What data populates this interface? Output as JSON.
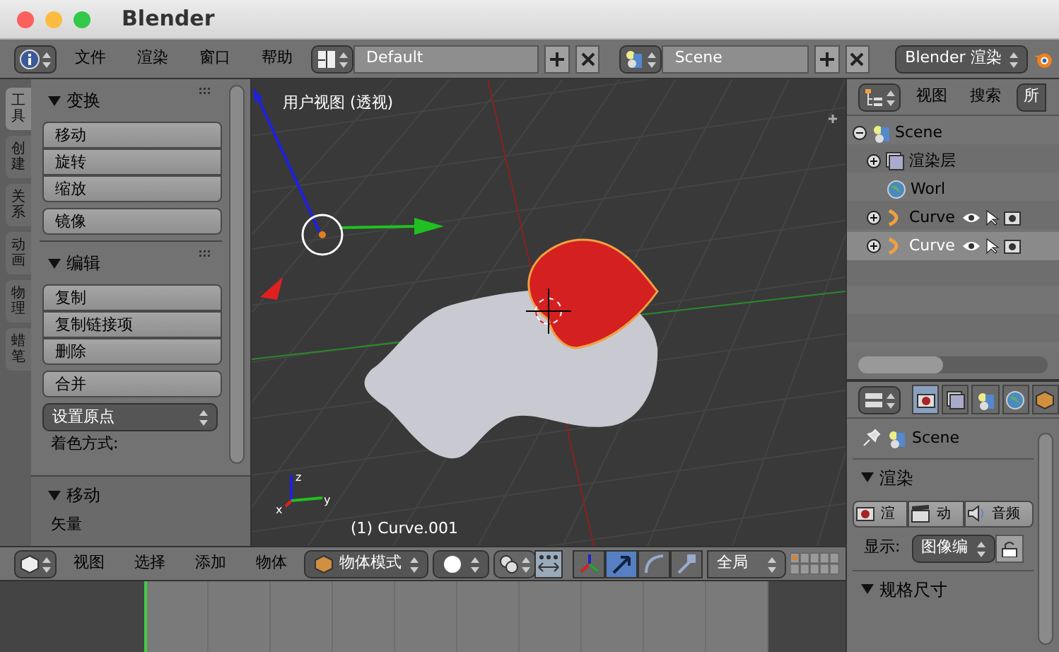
{
  "window": {
    "title": "Blender"
  },
  "info_header": {
    "menus": [
      "文件",
      "渲染",
      "窗口",
      "帮助"
    ],
    "layout": "Default",
    "scene": "Scene",
    "engine": "Blender 渲染"
  },
  "tool_shelf": {
    "tabs": [
      {
        "label": "工具",
        "selected": true
      },
      {
        "label": "创建",
        "selected": false
      },
      {
        "label": "关系",
        "selected": false
      },
      {
        "label": "动画",
        "selected": false
      },
      {
        "label": "物理",
        "selected": false
      },
      {
        "label": "蜡笔",
        "selected": false
      }
    ],
    "panels": [
      {
        "title": "变换",
        "groups": [
          [
            "移动",
            "旋转",
            "缩放"
          ],
          [
            "镜像"
          ]
        ]
      },
      {
        "title": "编辑",
        "groups": [
          [
            "复制",
            "复制链接项",
            "删除"
          ],
          [
            "合并"
          ]
        ],
        "dropdown": "设置原点",
        "label": "着色方式:"
      }
    ]
  },
  "operator_panel": {
    "title": "移动",
    "label": "矢量"
  },
  "viewport": {
    "view_label": "用户视图 (透视)",
    "object_label": "(1) Curve.001",
    "axis_labels": [
      "z",
      "x",
      "y"
    ]
  },
  "viewport_header": {
    "menus": [
      "视图",
      "选择",
      "添加",
      "物体"
    ],
    "mode": "物体模式",
    "orientation": "全局",
    "manipulators": [
      {
        "kind": "axes",
        "selected": false
      },
      {
        "kind": "translate",
        "selected": true
      },
      {
        "kind": "rotate",
        "selected": false
      },
      {
        "kind": "scale",
        "selected": false
      }
    ]
  },
  "outliner": {
    "menus": [
      "视图",
      "搜索"
    ],
    "filter": "所",
    "items": [
      {
        "kind": "scene",
        "label": "Scene",
        "expanded": true,
        "selected": false,
        "children": [
          {
            "kind": "layers",
            "label": "渲染层",
            "expanded": false,
            "selected": false
          },
          {
            "kind": "world",
            "label": "Worl",
            "selected": false
          },
          {
            "kind": "curve",
            "label": "Curve",
            "expanded": false,
            "selected": false
          },
          {
            "kind": "curve",
            "label": "Curve",
            "expanded": false,
            "selected": true
          }
        ]
      }
    ]
  },
  "properties": {
    "tabs": [
      {
        "kind": "render",
        "selected": true
      },
      {
        "kind": "layers",
        "selected": false
      },
      {
        "kind": "scene",
        "selected": false
      },
      {
        "kind": "world",
        "selected": false
      },
      {
        "kind": "object",
        "selected": false
      }
    ],
    "context": "Scene",
    "render_panel": {
      "title": "渲染",
      "buttons": [
        {
          "kind": "render",
          "label": "渲"
        },
        {
          "kind": "animation",
          "label": "动"
        },
        {
          "kind": "audio",
          "label": "音频"
        }
      ],
      "display_label": "显示:",
      "display_value": "图像编"
    },
    "size_panel": {
      "title": "规格尺寸"
    }
  }
}
